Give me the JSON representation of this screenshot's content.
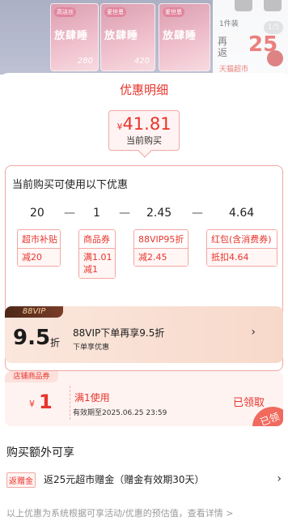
{
  "header": {
    "title": "优惠明细"
  },
  "price_box": {
    "currency": "¥",
    "amount": "41.81",
    "label": "当前购买"
  },
  "product_banner": {
    "packs": [
      {
        "brand": "高洁丝",
        "title": "放肆睡",
        "num": "280"
      },
      {
        "brand": "爱世恩",
        "title": "放肆睡",
        "num": "420"
      },
      {
        "brand": "爱世恩",
        "title": "放肆睡",
        "num": ""
      }
    ],
    "price_sub": "1件装",
    "again": "再\n返",
    "big_price": "25",
    "mall": "天猫超市",
    "counter": "1/5"
  },
  "discount_card": {
    "heading": "当前购买可使用以下优惠",
    "formula": [
      "20",
      "—",
      "1",
      "—",
      "2.45",
      "—",
      "4.64"
    ],
    "chips": [
      {
        "title": "超市补贴",
        "body": "减20"
      },
      {
        "title": "商品券",
        "body": "满1.01\n减1"
      },
      {
        "title": "88VIP95折",
        "body": "减2.45"
      },
      {
        "title": "红包(含消费券)",
        "body": "抵扣4.64"
      }
    ]
  },
  "vip_card": {
    "tag": "88VIP",
    "big": "9.5",
    "unit": "折",
    "line1": "88VIP下单再享9.5折",
    "line2": "下单享优惠"
  },
  "store_coupon": {
    "tag": "店铺商品券",
    "currency": "¥",
    "value": "1",
    "condition": "满1使用",
    "expiry": "有效期至2025.06.25 23:59",
    "status": "已领取",
    "stamp": "已领"
  },
  "extra": {
    "title": "购买额外可享",
    "badge": "返赠金",
    "text": "返25元超市赠金（赠金有效期30天）"
  },
  "footnote": "以上优惠为系统根据可享活动/优惠的预估值，查看详情 >"
}
